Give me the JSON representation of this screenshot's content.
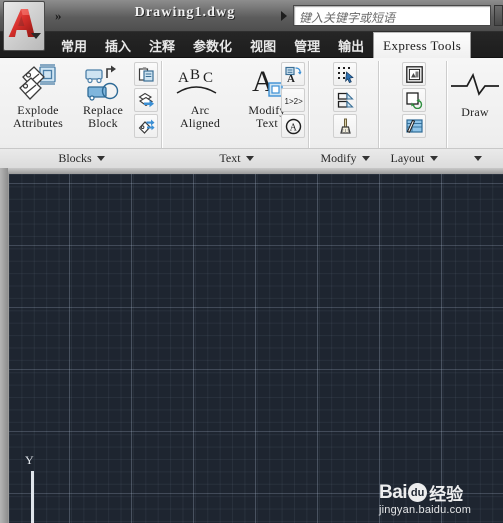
{
  "window": {
    "app_icon": "autocad-logo-icon",
    "quick_access_glyph": "»",
    "document_title": "Drawing1.dwg",
    "title_dropdown_icon": "triangle-right-icon"
  },
  "search": {
    "placeholder": "键入关键字或短语",
    "value": "",
    "button_icon": "search-dropdown-icon"
  },
  "tabs": [
    {
      "label": "常用",
      "name": "tab-home",
      "active": false,
      "latin": false
    },
    {
      "label": "插入",
      "name": "tab-insert",
      "active": false,
      "latin": false
    },
    {
      "label": "注释",
      "name": "tab-annotate",
      "active": false,
      "latin": false
    },
    {
      "label": "参数化",
      "name": "tab-parametric",
      "active": false,
      "latin": false
    },
    {
      "label": "视图",
      "name": "tab-view",
      "active": false,
      "latin": false
    },
    {
      "label": "管理",
      "name": "tab-manage",
      "active": false,
      "latin": false
    },
    {
      "label": "输出",
      "name": "tab-output",
      "active": false,
      "latin": false
    },
    {
      "label": "Express Tools",
      "name": "tab-express-tools",
      "active": true,
      "latin": true
    }
  ],
  "ribbon": {
    "panels": [
      {
        "name": "panel-blocks",
        "label": "Blocks",
        "buttons": [
          {
            "label_line1": "Explode",
            "label_line2": "Attributes",
            "icon": "explode-attributes-icon",
            "name": "explode-attributes-button"
          },
          {
            "label_line1": "Replace",
            "label_line2": "Block",
            "icon": "replace-block-icon",
            "name": "replace-block-button"
          }
        ],
        "small_buttons": [
          {
            "icon": "copy-nested-objects-icon",
            "name": "copy-nested-objects-button"
          },
          {
            "icon": "export-attributes-icon",
            "name": "export-attributes-button"
          },
          {
            "icon": "import-attributes-icon",
            "name": "import-attributes-button"
          }
        ]
      },
      {
        "name": "panel-text",
        "label": "Text",
        "buttons": [
          {
            "label_line1": "Arc",
            "label_line2": "Aligned",
            "icon": "arc-aligned-text-icon",
            "name": "arc-aligned-text-button"
          },
          {
            "label_line1": "Modify",
            "label_line2": "Text",
            "icon": "modify-text-icon",
            "name": "modify-text-button",
            "has_dropdown": true
          }
        ],
        "small_buttons": [
          {
            "icon": "convert-to-mtext-icon",
            "name": "convert-to-mtext-button"
          },
          {
            "icon": "automatic-numbering-icon",
            "name": "automatic-numbering-button"
          },
          {
            "icon": "enclose-text-icon",
            "name": "enclose-text-button"
          }
        ]
      },
      {
        "name": "panel-modify",
        "label": "Modify",
        "buttons": [],
        "small_buttons": [
          {
            "icon": "multiple-object-select-icon",
            "name": "multiple-object-select-button"
          },
          {
            "icon": "extended-trim-icon",
            "name": "extended-trim-button"
          },
          {
            "icon": "flatten-objects-icon",
            "name": "flatten-objects-button"
          }
        ]
      },
      {
        "name": "panel-layout",
        "label": "Layout",
        "buttons": [],
        "small_buttons": [
          {
            "icon": "align-space-viewport-icon",
            "name": "align-space-viewport-button"
          },
          {
            "icon": "sync-viewports-icon",
            "name": "sync-viewports-button"
          },
          {
            "icon": "list-viewport-scale-icon",
            "name": "list-viewport-scale-button"
          }
        ]
      },
      {
        "name": "panel-draw",
        "label": "",
        "buttons": [
          {
            "label_line1": "Draw",
            "label_line2": "",
            "icon": "break-line-symbol-icon",
            "name": "draw-break-line-button"
          }
        ],
        "small_buttons": []
      }
    ]
  },
  "canvas": {
    "background_color": "#1e2530",
    "grid_color": "#a8b7cb",
    "ucs_axis_label": "Y",
    "ucs_icon": "ucs-y-axis-icon"
  },
  "watermark": {
    "brand": "Bai",
    "brand_tail": "du",
    "suffix": "经验",
    "url": "jingyan.baidu.com"
  }
}
